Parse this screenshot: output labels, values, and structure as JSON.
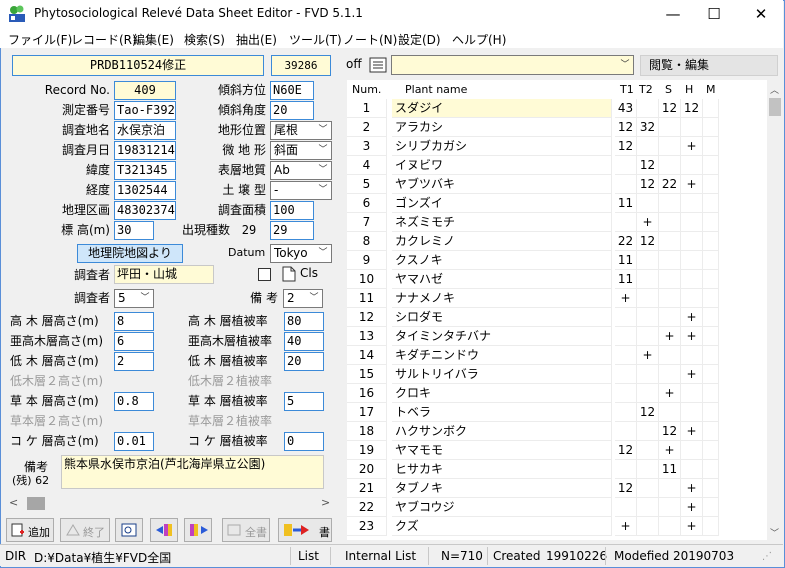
{
  "window": {
    "title": "Phytosociological Relevé Data Sheet Editor -  FVD 5.1.1",
    "minimize": "—",
    "maximize": "☐",
    "close": "✕"
  },
  "menu": [
    "ファイル(F)",
    "レコード(R)",
    "編集(E)",
    "検索(S)",
    "抽出(E)",
    "ツール(T)",
    "ノート(N)",
    "設定(D)",
    "ヘルプ(H)"
  ],
  "header": {
    "record_title": "PRDB110524修正",
    "record_id": "39286"
  },
  "form": {
    "record_no": {
      "label": "Record No.",
      "value": "409"
    },
    "measure_no": {
      "label": "測定番号",
      "value": "Tao-F392"
    },
    "site_name": {
      "label": "調査地名",
      "value": "水俣京泊"
    },
    "survey_date": {
      "label": "調査月日",
      "value": "19831214"
    },
    "latitude": {
      "label": "緯度",
      "value": "T321345"
    },
    "longitude": {
      "label": "経度",
      "value": "1302544"
    },
    "geo_grid": {
      "label": "地理区画",
      "value": "48302374"
    },
    "altitude": {
      "label": "標 高(m)",
      "value": "30"
    },
    "slope_dir": {
      "label": "傾斜方位",
      "value": "N60E"
    },
    "slope_angle": {
      "label": "傾斜角度",
      "value": "20"
    },
    "terrain": {
      "label": "地形位置",
      "value": "尾根"
    },
    "micro_terrain": {
      "label": "微 地 形",
      "value": "斜面"
    },
    "surface_geo": {
      "label": "表層地質",
      "value": "Ab"
    },
    "soil_type": {
      "label": "土 壌 型",
      "value": "-"
    },
    "survey_area": {
      "label": "調査面積",
      "value": "100"
    },
    "species_count": {
      "label": "出現種数",
      "value": "29",
      "value2": "29"
    },
    "geo_button": "地理院地図より",
    "datum": {
      "label": "Datum",
      "value": "Tokyo"
    },
    "surveyor": {
      "label": "調査者",
      "value": "坪田・山城"
    },
    "cls_label": "Cls",
    "surveyor_count": {
      "label": "調査者",
      "value": "5"
    },
    "remarks_count": {
      "label": "備 考",
      "value": "2"
    },
    "layers": [
      {
        "h_label": "高 木 層高さ(m)",
        "h_value": "8",
        "c_label": "高 木 層植被率",
        "c_value": "80",
        "disabled": false
      },
      {
        "h_label": "亜高木層高さ(m)",
        "h_value": "6",
        "c_label": "亜高木層植被率",
        "c_value": "40",
        "disabled": false
      },
      {
        "h_label": "低 木 層高さ(m)",
        "h_value": "2",
        "c_label": "低 木 層植被率",
        "c_value": "20",
        "disabled": false
      },
      {
        "h_label": "低木層２高さ(m)",
        "h_value": "",
        "c_label": "低木層２植被率",
        "c_value": "",
        "disabled": true
      },
      {
        "h_label": "草 本 層高さ(m)",
        "h_value": "0.8",
        "c_label": "草 本 層植被率",
        "c_value": "5",
        "disabled": false
      },
      {
        "h_label": "草本層２高さ(m)",
        "h_value": "",
        "c_label": "草本層２植被率",
        "c_value": "",
        "disabled": true
      },
      {
        "h_label": "コ ケ 層高さ(m)",
        "h_value": "0.01",
        "c_label": "コ ケ 層植被率",
        "c_value": "0",
        "disabled": false
      }
    ],
    "notes": {
      "label": "備考",
      "sublabel": "(残) 62",
      "value": "熊本県水俣市京泊(芦北海岸県立公園)"
    }
  },
  "toolbar": {
    "add": "追加",
    "finish": "終了",
    "all": "全書",
    "write": "書"
  },
  "right": {
    "off_label": "off",
    "browse_edit": "閲覧・編集",
    "columns": [
      "Num.",
      "Plant name",
      "T1",
      "T2",
      "S",
      "H",
      "M"
    ],
    "rows": [
      {
        "num": "1",
        "name": "スダジイ",
        "t1": "43",
        "t2": "",
        "s": "12",
        "h": "12",
        "m": ""
      },
      {
        "num": "2",
        "name": "アラカシ",
        "t1": "12",
        "t2": "32",
        "s": "",
        "h": "",
        "m": ""
      },
      {
        "num": "3",
        "name": "シリブカガシ",
        "t1": "12",
        "t2": "",
        "s": "",
        "h": "+",
        "m": ""
      },
      {
        "num": "4",
        "name": "イヌビワ",
        "t1": "",
        "t2": "12",
        "s": "",
        "h": "",
        "m": ""
      },
      {
        "num": "5",
        "name": "ヤブツバキ",
        "t1": "",
        "t2": "12",
        "s": "22",
        "h": "+",
        "m": ""
      },
      {
        "num": "6",
        "name": "ゴンズイ",
        "t1": "11",
        "t2": "",
        "s": "",
        "h": "",
        "m": ""
      },
      {
        "num": "7",
        "name": "ネズミモチ",
        "t1": "",
        "t2": "+",
        "s": "",
        "h": "",
        "m": ""
      },
      {
        "num": "8",
        "name": "カクレミノ",
        "t1": "22",
        "t2": "12",
        "s": "",
        "h": "",
        "m": ""
      },
      {
        "num": "9",
        "name": "クスノキ",
        "t1": "11",
        "t2": "",
        "s": "",
        "h": "",
        "m": ""
      },
      {
        "num": "10",
        "name": "ヤマハゼ",
        "t1": "11",
        "t2": "",
        "s": "",
        "h": "",
        "m": ""
      },
      {
        "num": "11",
        "name": "ナナメノキ",
        "t1": "+",
        "t2": "",
        "s": "",
        "h": "",
        "m": ""
      },
      {
        "num": "12",
        "name": "シロダモ",
        "t1": "",
        "t2": "",
        "s": "",
        "h": "+",
        "m": ""
      },
      {
        "num": "13",
        "name": "タイミンタチバナ",
        "t1": "",
        "t2": "",
        "s": "+",
        "h": "+",
        "m": ""
      },
      {
        "num": "14",
        "name": "キダチニンドウ",
        "t1": "",
        "t2": "+",
        "s": "",
        "h": "",
        "m": ""
      },
      {
        "num": "15",
        "name": "サルトリイバラ",
        "t1": "",
        "t2": "",
        "s": "",
        "h": "+",
        "m": ""
      },
      {
        "num": "16",
        "name": "クロキ",
        "t1": "",
        "t2": "",
        "s": "+",
        "h": "",
        "m": ""
      },
      {
        "num": "17",
        "name": "トベラ",
        "t1": "",
        "t2": "12",
        "s": "",
        "h": "",
        "m": ""
      },
      {
        "num": "18",
        "name": "ハクサンボク",
        "t1": "",
        "t2": "",
        "s": "12",
        "h": "+",
        "m": ""
      },
      {
        "num": "19",
        "name": "ヤマモモ",
        "t1": "12",
        "t2": "",
        "s": "+",
        "h": "",
        "m": ""
      },
      {
        "num": "20",
        "name": "ヒサカキ",
        "t1": "",
        "t2": "",
        "s": "11",
        "h": "",
        "m": ""
      },
      {
        "num": "21",
        "name": "タブノキ",
        "t1": "12",
        "t2": "",
        "s": "",
        "h": "+",
        "m": ""
      },
      {
        "num": "22",
        "name": "ヤブコウジ",
        "t1": "",
        "t2": "",
        "s": "",
        "h": "+",
        "m": ""
      },
      {
        "num": "23",
        "name": "クズ",
        "t1": "+",
        "t2": "",
        "s": "",
        "h": "+",
        "m": ""
      }
    ]
  },
  "status": {
    "dir_label": "DIR",
    "dir": "D:¥Data¥植生¥FVD全国",
    "mode1": "List",
    "mode2": "Internal List",
    "count": "N=710",
    "created_label": "Created",
    "created": "19910226",
    "modified_label": "Modefied",
    "modified": "20190703"
  }
}
